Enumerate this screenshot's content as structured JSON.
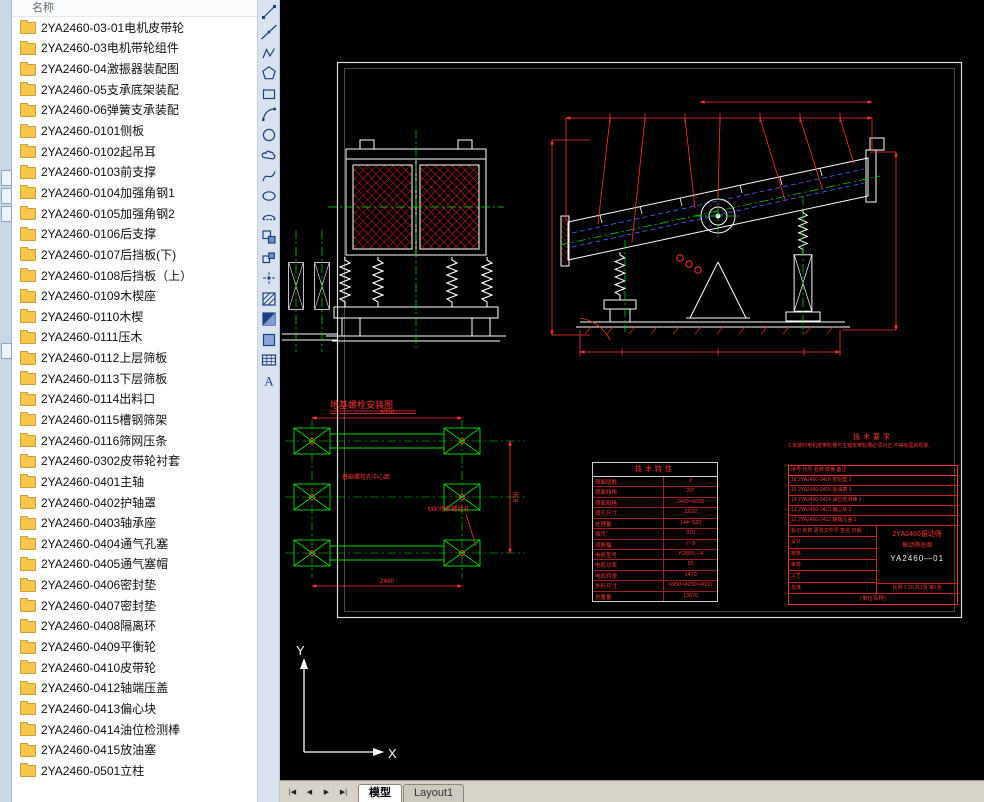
{
  "file_panel": {
    "header": "名称",
    "items": [
      "2YA2460-03-01电机皮带轮",
      "2YA2460-03电机带轮组件",
      "2YA2460-04激振器装配图",
      "2YA2460-05支承底架装配",
      "2YA2460-06弹簧支承装配",
      "2YA2460-0101侧板",
      "2YA2460-0102起吊耳",
      "2YA2460-0103前支撑",
      "2YA2460-0104加强角钢1",
      "2YA2460-0105加强角钢2",
      "2YA2460-0106后支撑",
      "2YA2460-0107后挡板(下)",
      "2YA2460-0108后挡板（上）",
      "2YA2460-0109木楔座",
      "2YA2460-0110木楔",
      "2YA2460-0111压木",
      "2YA2460-0112上层筛板",
      "2YA2460-0113下层筛板",
      "2YA2460-0114出料口",
      "2YA2460-0115槽钢筛架",
      "2YA2460-0116筛网压条",
      "2YA2460-0302皮带轮衬套",
      "2YA2460-0401主轴",
      "2YA2460-0402护轴罩",
      "2YA2460-0403轴承座",
      "2YA2460-0404通气孔塞",
      "2YA2460-0405通气塞帽",
      "2YA2460-0406密封垫",
      "2YA2460-0407密封垫",
      "2YA2460-0408隔离环",
      "2YA2460-0409平衡轮",
      "2YA2460-0410皮带轮",
      "2YA2460-0412轴端压盖",
      "2YA2460-0413偏心块",
      "2YA2460-0414油位检测棒",
      "2YA2460-0415放油塞",
      "2YA2460-0501立柱"
    ]
  },
  "draw_toolbar": {
    "mtext_glyph": "A",
    "tools": [
      {
        "id": "line",
        "label": "直线"
      },
      {
        "id": "xline",
        "label": "构造线"
      },
      {
        "id": "pline",
        "label": "多段线"
      },
      {
        "id": "polygon",
        "label": "正多边形"
      },
      {
        "id": "rect",
        "label": "矩形"
      },
      {
        "id": "arc",
        "label": "圆弧"
      },
      {
        "id": "circle",
        "label": "圆"
      },
      {
        "id": "revcloud",
        "label": "修订云线"
      },
      {
        "id": "spline",
        "label": "样条曲线"
      },
      {
        "id": "ellipse",
        "label": "椭圆"
      },
      {
        "id": "ellipse-arc",
        "label": "椭圆弧"
      },
      {
        "id": "insert",
        "label": "插入块"
      },
      {
        "id": "block",
        "label": "创建块"
      },
      {
        "id": "point",
        "label": "点"
      },
      {
        "id": "hatch",
        "label": "图案填充"
      },
      {
        "id": "gradient",
        "label": "渐变色"
      },
      {
        "id": "region",
        "label": "面域"
      },
      {
        "id": "table",
        "label": "表格"
      },
      {
        "id": "mtext",
        "label": "多行文字"
      }
    ]
  },
  "canvas": {
    "foundation": {
      "title": "地基螺栓安装图",
      "note_center": "基础螺栓孔中心距",
      "note_leader": "M30地脚螺栓孔",
      "dims": [
        "3050",
        "2460",
        "930"
      ]
    },
    "tech_table": {
      "title": "技术特性",
      "rows": [
        [
          "筛面层数",
          "2"
        ],
        [
          "筛面倾角",
          "20°"
        ],
        [
          "筛面规格",
          "2400×6000"
        ],
        [
          "筛孔尺寸",
          "13/32"
        ],
        [
          "处理量",
          "144~520"
        ],
        [
          "振次",
          "970"
        ],
        [
          "双振幅",
          "7~9"
        ],
        [
          "电机型号",
          "Y280S—4"
        ],
        [
          "电机功率",
          "55"
        ],
        [
          "电机转速",
          "1470"
        ],
        [
          "外形尺寸",
          "6950×4250×4600"
        ],
        [
          "总重量",
          "13970"
        ]
      ]
    },
    "tech_req": {
      "title": "技术要求",
      "line1": "1.安装时电机皮带轮槽与主轴皮带轮槽必须对正,不得有歪斜现象。"
    },
    "title_block": {
      "parts_header": "序号  代号  名称  数量  备注",
      "parts_rows": [
        "16  2YA2460-0416  密封垫  1",
        "15  2YA2460-0415  放油塞  1",
        "14  2YA2460-0414  油位检测棒  1",
        "13  2YA2460-0413  偏心块  2",
        "12  2YA2460-0412  轴端压盖  2"
      ],
      "left_rows": [
        "标记 处数 更改文件号 签名 日期",
        "设计",
        "校核",
        "审核",
        "工艺",
        "批准"
      ],
      "product": "2YA2460振动筛",
      "subtitle": "振动筛总图",
      "drawing_no": "YA2460—01",
      "scale_row": "比例 1:20  共1张 第1张",
      "bottom_note": "(单位名称)"
    },
    "ucs": {
      "x_label": "X",
      "y_label": "Y"
    }
  },
  "tab_bar": {
    "nav": [
      {
        "id": "first",
        "glyph": "|◀"
      },
      {
        "id": "prev",
        "glyph": "◀"
      },
      {
        "id": "next",
        "glyph": "▶"
      },
      {
        "id": "last",
        "glyph": "▶|"
      }
    ],
    "tabs": [
      {
        "id": "model",
        "label": "模型",
        "active": true
      },
      {
        "id": "layout1",
        "label": "Layout1",
        "active": false
      }
    ]
  },
  "colors": {
    "canvas_bg": "#000000",
    "line_white": "#ffffff",
    "dim_red": "#ff3333",
    "center_green": "#00dd00",
    "hidden_blue": "#4466ff",
    "toolbar_bg": "#d9e3f0",
    "folder_yellow": "#f7c64a"
  }
}
